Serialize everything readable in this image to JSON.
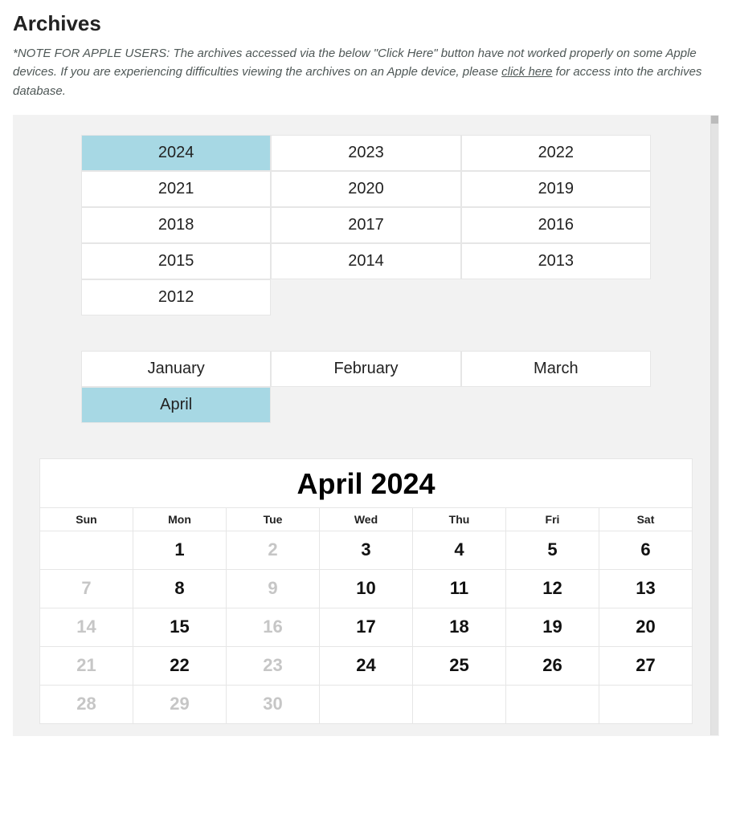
{
  "title": "Archives",
  "note": {
    "prefix": "*NOTE FOR APPLE USERS: The archives accessed via the below \"Click Here\" button have not worked properly on some Apple devices. If you are experiencing difficulties viewing the archives on an Apple device, please ",
    "link_text": "click here",
    "suffix": " for access into the archives database."
  },
  "years": {
    "values": [
      "2024",
      "2023",
      "2022",
      "2021",
      "2020",
      "2019",
      "2018",
      "2017",
      "2016",
      "2015",
      "2014",
      "2013",
      "2012"
    ],
    "selected": "2024"
  },
  "months": {
    "values": [
      "January",
      "February",
      "March",
      "April"
    ],
    "selected": "April"
  },
  "calendar": {
    "caption": "April 2024",
    "weekdays": [
      "Sun",
      "Mon",
      "Tue",
      "Wed",
      "Thu",
      "Fri",
      "Sat"
    ],
    "rows": [
      [
        {
          "d": "",
          "dim": false
        },
        {
          "d": "1",
          "dim": false
        },
        {
          "d": "2",
          "dim": true
        },
        {
          "d": "3",
          "dim": false
        },
        {
          "d": "4",
          "dim": false
        },
        {
          "d": "5",
          "dim": false
        },
        {
          "d": "6",
          "dim": false
        }
      ],
      [
        {
          "d": "7",
          "dim": true
        },
        {
          "d": "8",
          "dim": false
        },
        {
          "d": "9",
          "dim": true
        },
        {
          "d": "10",
          "dim": false
        },
        {
          "d": "11",
          "dim": false
        },
        {
          "d": "12",
          "dim": false
        },
        {
          "d": "13",
          "dim": false
        }
      ],
      [
        {
          "d": "14",
          "dim": true
        },
        {
          "d": "15",
          "dim": false
        },
        {
          "d": "16",
          "dim": true
        },
        {
          "d": "17",
          "dim": false
        },
        {
          "d": "18",
          "dim": false
        },
        {
          "d": "19",
          "dim": false
        },
        {
          "d": "20",
          "dim": false
        }
      ],
      [
        {
          "d": "21",
          "dim": true
        },
        {
          "d": "22",
          "dim": false
        },
        {
          "d": "23",
          "dim": true
        },
        {
          "d": "24",
          "dim": false
        },
        {
          "d": "25",
          "dim": false
        },
        {
          "d": "26",
          "dim": false
        },
        {
          "d": "27",
          "dim": false
        }
      ],
      [
        {
          "d": "28",
          "dim": true
        },
        {
          "d": "29",
          "dim": true
        },
        {
          "d": "30",
          "dim": true
        },
        {
          "d": "",
          "dim": false
        },
        {
          "d": "",
          "dim": false
        },
        {
          "d": "",
          "dim": false
        },
        {
          "d": "",
          "dim": false
        }
      ]
    ]
  }
}
